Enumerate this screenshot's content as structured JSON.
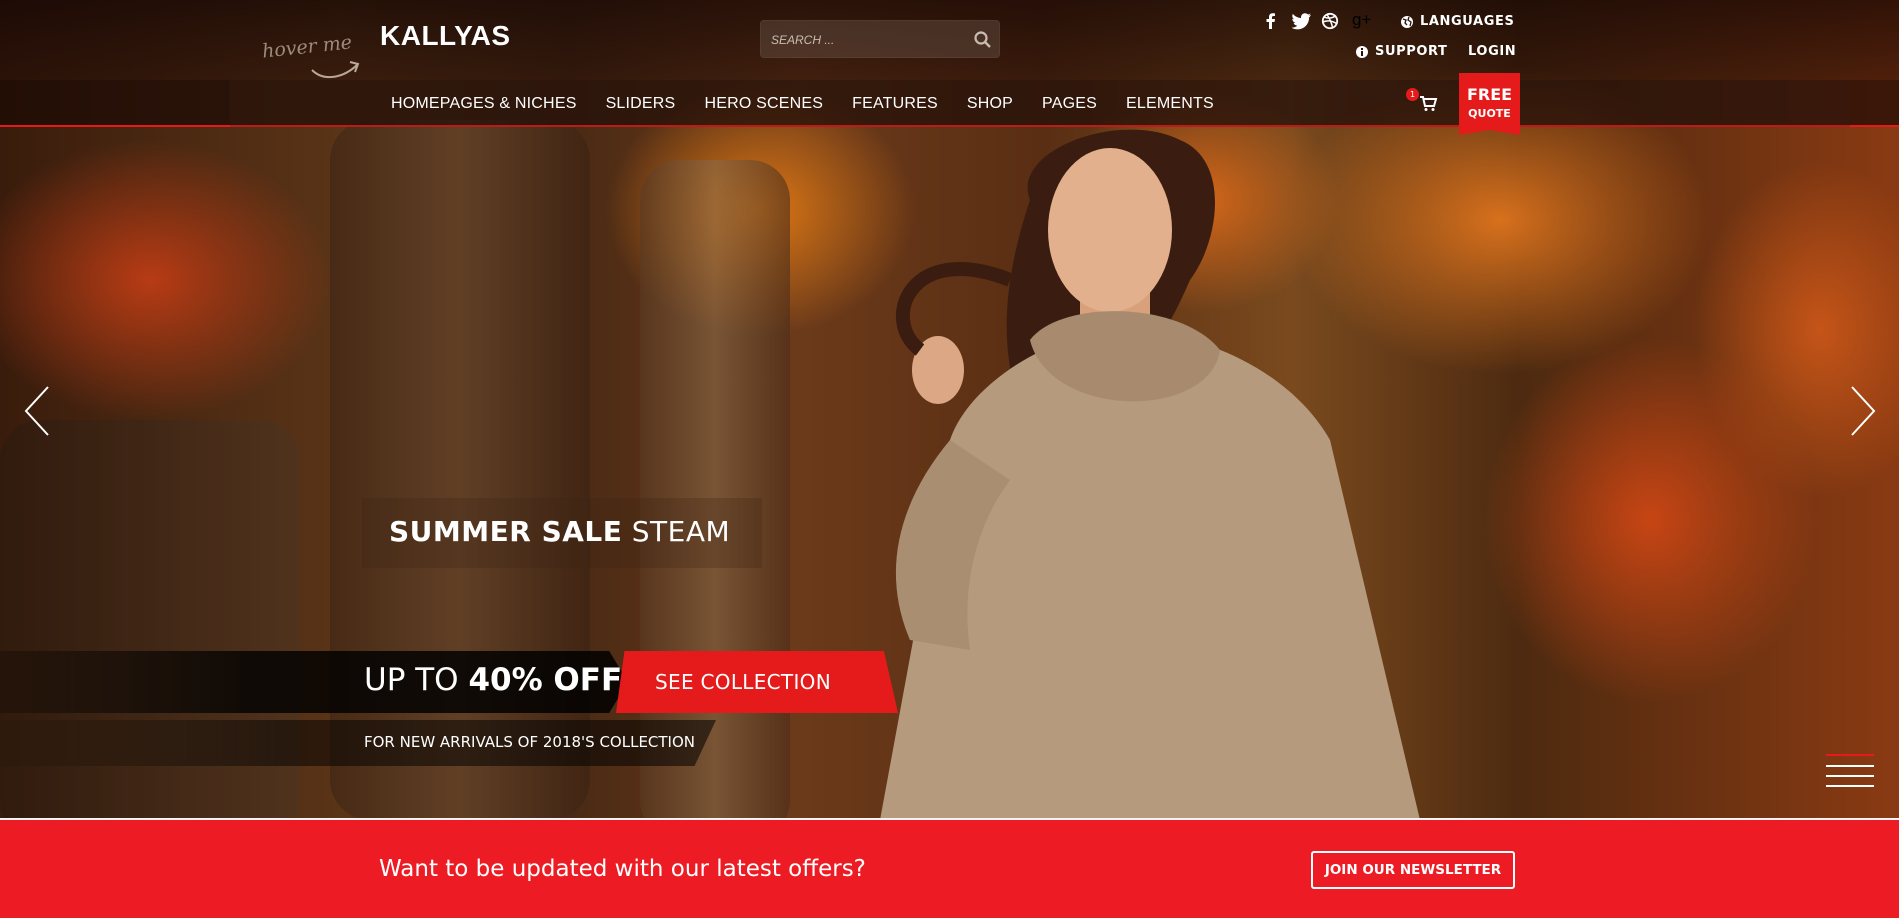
{
  "header": {
    "hover_hint": "hover me",
    "logo": "KALLYAS",
    "search": {
      "placeholder": "SEARCH ..."
    },
    "social": [
      {
        "name": "facebook-icon",
        "glyph": "f"
      },
      {
        "name": "twitter-icon",
        "glyph": "t"
      },
      {
        "name": "dribbble-icon",
        "glyph": "d"
      },
      {
        "name": "google-plus-icon",
        "glyph": "g+"
      }
    ],
    "languages_label": "LANGUAGES",
    "support_label": "SUPPORT",
    "login_label": "LOGIN"
  },
  "nav": {
    "items": [
      "HOMEPAGES & NICHES",
      "SLIDERS",
      "HERO SCENES",
      "FEATURES",
      "SHOP",
      "PAGES",
      "ELEMENTS"
    ],
    "cart_count": "1",
    "free_quote_line1": "FREE",
    "free_quote_line2": "QUOTE"
  },
  "slider": {
    "caption_title_bold": "SUMMER SALE",
    "caption_title_light": " STEAM",
    "offer_prefix": "UP TO ",
    "offer_bold": "40% OFF",
    "cta_label": "SEE COLLECTION",
    "subtext": "FOR NEW ARRIVALS OF 2018'S COLLECTION"
  },
  "newsletter": {
    "text": "Want to be updated with our latest offers?",
    "button_label": "JOIN OUR NEWSLETTER"
  },
  "colors": {
    "accent": "#e51b1b",
    "newsletter_bg": "#ed1c24"
  }
}
